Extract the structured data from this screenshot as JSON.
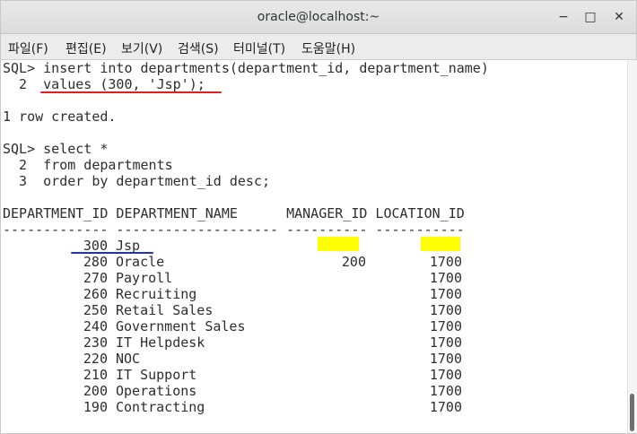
{
  "window": {
    "title": "oracle@localhost:~",
    "buttons": {
      "minimize": "−",
      "maximize": "□",
      "close": "✕"
    }
  },
  "menu": [
    "파일(F)",
    "편집(E)",
    "보기(V)",
    "검색(S)",
    "터미널(T)",
    "도움말(H)"
  ],
  "terminal": {
    "lines": [
      "SQL> insert into departments(department_id, department_name)",
      "  2  values (300, 'Jsp');",
      "",
      "1 row created.",
      "",
      "SQL> select *",
      "  2  from departments",
      "  3  order by department_id desc;",
      "",
      "DEPARTMENT_ID DEPARTMENT_NAME      MANAGER_ID LOCATION_ID",
      "------------- -------------------- ---------- -----------"
    ],
    "rows": [
      {
        "id": "300",
        "name": "Jsp",
        "manager": "",
        "location": ""
      },
      {
        "id": "280",
        "name": "Oracle",
        "manager": "200",
        "location": "1700"
      },
      {
        "id": "270",
        "name": "Payroll",
        "manager": "",
        "location": "1700"
      },
      {
        "id": "260",
        "name": "Recruiting",
        "manager": "",
        "location": "1700"
      },
      {
        "id": "250",
        "name": "Retail Sales",
        "manager": "",
        "location": "1700"
      },
      {
        "id": "240",
        "name": "Government Sales",
        "manager": "",
        "location": "1700"
      },
      {
        "id": "230",
        "name": "IT Helpdesk",
        "manager": "",
        "location": "1700"
      },
      {
        "id": "220",
        "name": "NOC",
        "manager": "",
        "location": "1700"
      },
      {
        "id": "210",
        "name": "IT Support",
        "manager": "",
        "location": "1700"
      },
      {
        "id": "200",
        "name": "Operations",
        "manager": "",
        "location": "1700"
      },
      {
        "id": "190",
        "name": "Contracting",
        "manager": "",
        "location": "1700"
      }
    ]
  },
  "colors": {
    "highlight": "#ffff00",
    "red_underline": "#e0201e",
    "blue_underline": "#1b33c8"
  }
}
